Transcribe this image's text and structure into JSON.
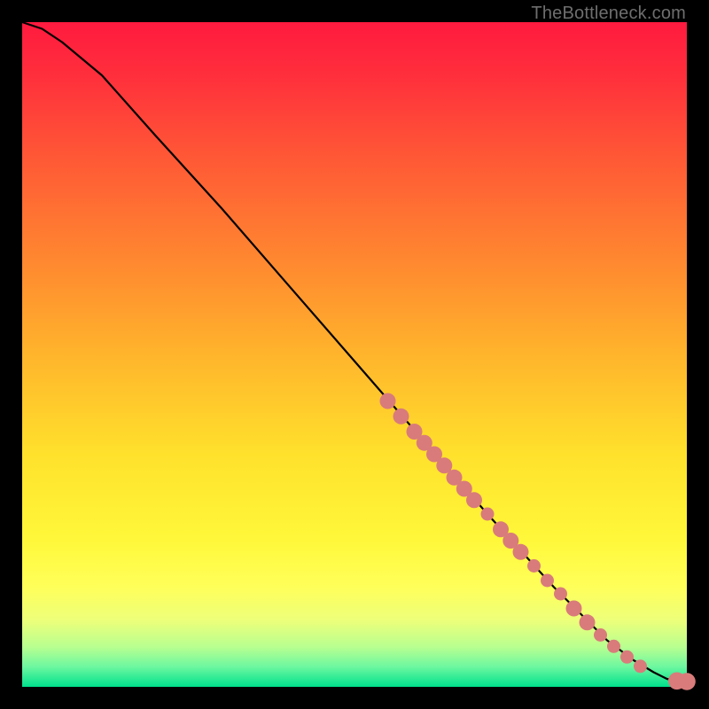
{
  "attribution": "TheBottleneck.com",
  "colors": {
    "dot": "#d97b7b",
    "curve": "#000000",
    "gradient_top": "#ff1a3f",
    "gradient_bottom": "#00e08c"
  },
  "chart_data": {
    "type": "line",
    "title": "",
    "xlabel": "",
    "ylabel": "",
    "xlim": [
      0,
      100
    ],
    "ylim": [
      0,
      100
    ],
    "grid": false,
    "legend": false,
    "series": [
      {
        "name": "curve",
        "x": [
          0,
          3,
          6,
          12,
          20,
          30,
          40,
          50,
          60,
          70,
          80,
          88,
          92,
          95,
          97,
          99,
          100
        ],
        "y": [
          100,
          99,
          97,
          92,
          83,
          72,
          60.5,
          49,
          37.5,
          26,
          15,
          7,
          4,
          2.2,
          1.2,
          0.8,
          0.8
        ]
      }
    ],
    "markers": [
      {
        "x": 55.0,
        "y": 43.0,
        "r": 1.2
      },
      {
        "x": 57.0,
        "y": 40.7,
        "r": 1.2
      },
      {
        "x": 59.0,
        "y": 38.4,
        "r": 1.2
      },
      {
        "x": 60.5,
        "y": 36.7,
        "r": 1.2
      },
      {
        "x": 62.0,
        "y": 35.0,
        "r": 1.2
      },
      {
        "x": 63.5,
        "y": 33.3,
        "r": 1.2
      },
      {
        "x": 65.0,
        "y": 31.5,
        "r": 1.2
      },
      {
        "x": 66.5,
        "y": 29.8,
        "r": 1.2
      },
      {
        "x": 68.0,
        "y": 28.1,
        "r": 1.2
      },
      {
        "x": 70.0,
        "y": 26.0,
        "r": 1.0
      },
      {
        "x": 72.0,
        "y": 23.7,
        "r": 1.2
      },
      {
        "x": 73.5,
        "y": 22.0,
        "r": 1.2
      },
      {
        "x": 75.0,
        "y": 20.3,
        "r": 1.2
      },
      {
        "x": 77.0,
        "y": 18.2,
        "r": 1.0
      },
      {
        "x": 79.0,
        "y": 16.0,
        "r": 1.0
      },
      {
        "x": 81.0,
        "y": 14.0,
        "r": 1.0
      },
      {
        "x": 83.0,
        "y": 11.8,
        "r": 1.2
      },
      {
        "x": 85.0,
        "y": 9.7,
        "r": 1.2
      },
      {
        "x": 87.0,
        "y": 7.8,
        "r": 1.0
      },
      {
        "x": 89.0,
        "y": 6.1,
        "r": 1.0
      },
      {
        "x": 91.0,
        "y": 4.5,
        "r": 1.0
      },
      {
        "x": 93.0,
        "y": 3.1,
        "r": 1.0
      },
      {
        "x": 98.5,
        "y": 0.9,
        "r": 1.3
      },
      {
        "x": 100.0,
        "y": 0.8,
        "r": 1.3
      }
    ]
  }
}
